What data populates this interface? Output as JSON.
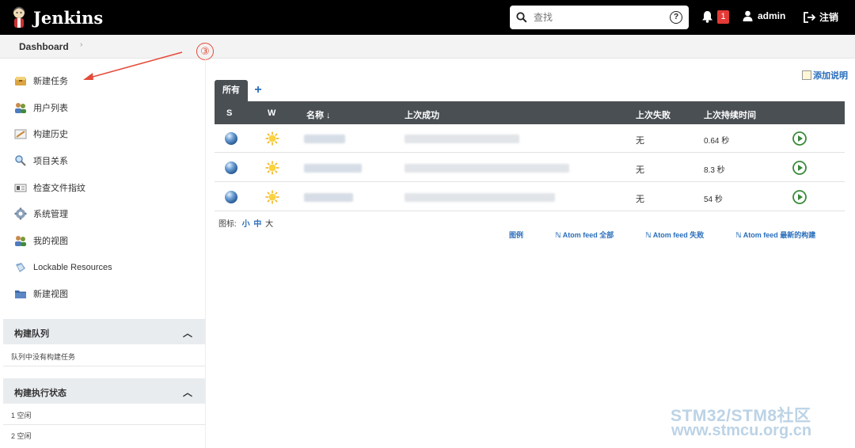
{
  "header": {
    "title": "Jenkins",
    "search_placeholder": "查找",
    "help_icon": "?",
    "notification_count": "1",
    "user": "admin",
    "logout": "注销"
  },
  "breadcrumb": {
    "dashboard": "Dashboard"
  },
  "annotation": {
    "number": "③",
    "color": "#e54b3a"
  },
  "sidebar": {
    "tasks": [
      {
        "label": "新建任务",
        "icon": "new-item-icon"
      },
      {
        "label": "用户列表",
        "icon": "users-icon"
      },
      {
        "label": "构建历史",
        "icon": "build-history-icon"
      },
      {
        "label": "项目关系",
        "icon": "project-relationship-icon"
      },
      {
        "label": "检查文件指纹",
        "icon": "fingerprint-icon"
      },
      {
        "label": "系统管理",
        "icon": "gear-icon"
      },
      {
        "label": "我的视图",
        "icon": "my-views-icon"
      },
      {
        "label": "Lockable Resources",
        "icon": "lockable-resources-icon"
      },
      {
        "label": "新建视图",
        "icon": "folder-icon"
      }
    ],
    "build_queue": {
      "title": "构建队列",
      "empty": "队列中没有构建任务"
    },
    "executors": {
      "title": "构建执行状态",
      "items": [
        "1  空闲",
        "2  空闲"
      ]
    }
  },
  "main": {
    "add_description": "添加说明",
    "tabs": {
      "active": "所有",
      "add": "+"
    },
    "columns": {
      "s": "S",
      "w": "W",
      "name": "名称 ↓",
      "last_success": "上次成功",
      "last_failure": "上次失败",
      "last_duration": "上次持续时间"
    },
    "rows": [
      {
        "last_failure": "无",
        "duration": "0.64 秒"
      },
      {
        "last_failure": "无",
        "duration": "8.3 秒"
      },
      {
        "last_failure": "无",
        "duration": "54 秒"
      }
    ],
    "icon_label": "图标:",
    "icon_sizes": {
      "small": "小",
      "medium": "中",
      "large": "大"
    },
    "footer_links": {
      "legend": "图例",
      "feed_all": "Atom feed 全部",
      "feed_failed": "Atom feed 失败",
      "feed_latest": "Atom feed 最新的构建"
    }
  },
  "watermark": {
    "line1": "STM32/STM8社区",
    "line2": "www.stmcu.org.cn"
  },
  "colors": {
    "header_bg": "#000000",
    "table_header": "#4a4f54",
    "link": "#2a6ebb",
    "badge": "#e43a37"
  }
}
